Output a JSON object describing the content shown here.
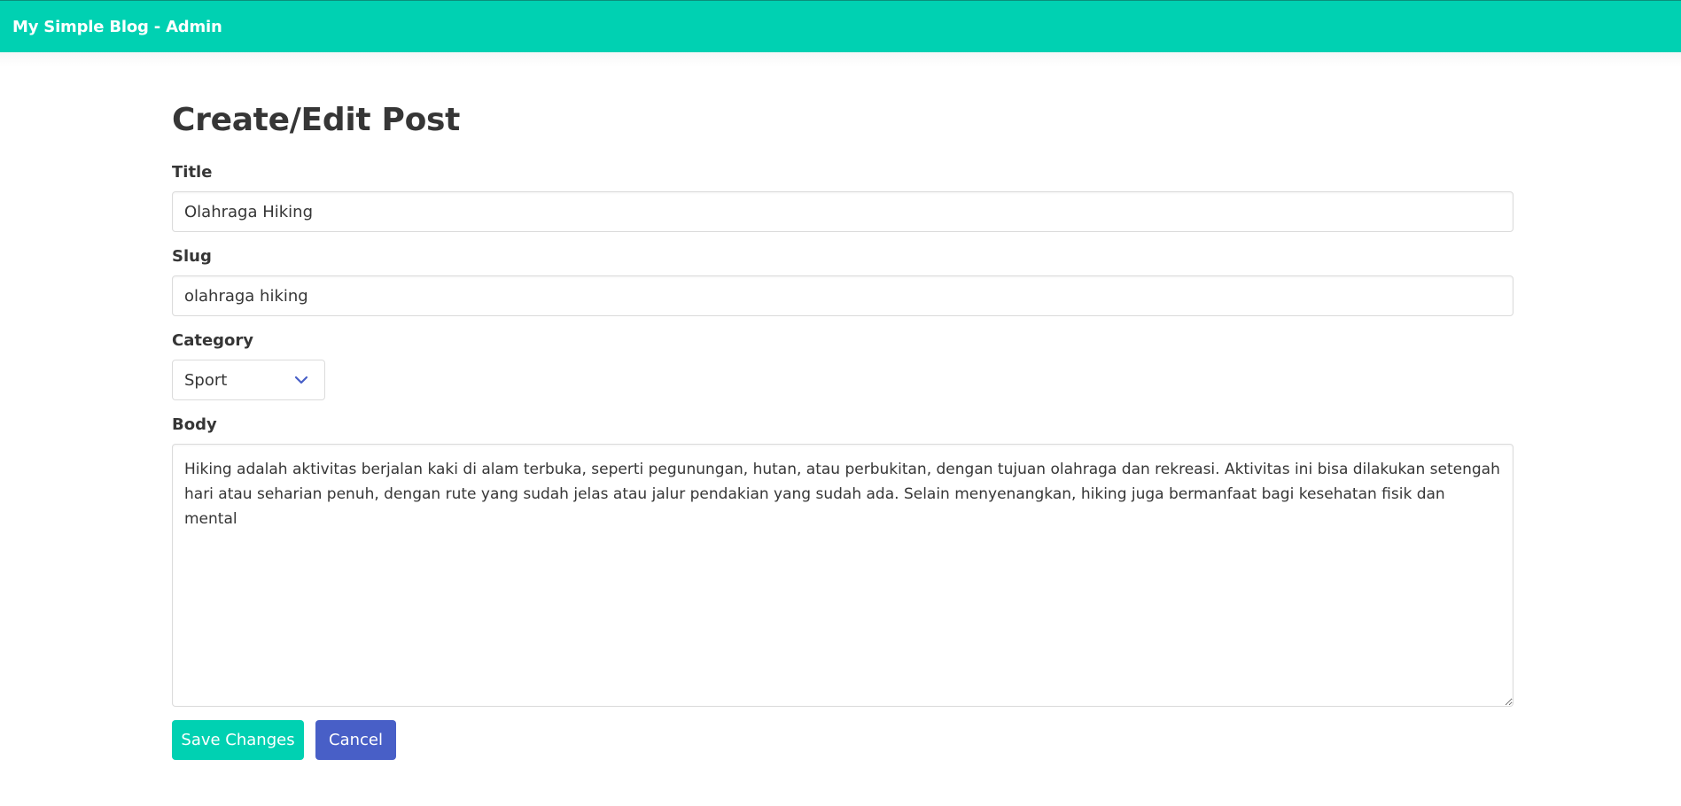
{
  "navbar": {
    "brand": "My Simple Blog - Admin",
    "color": "#00d1b2"
  },
  "page": {
    "title": "Create/Edit Post"
  },
  "form": {
    "title": {
      "label": "Title",
      "value": "Olahraga Hiking"
    },
    "slug": {
      "label": "Slug",
      "value": "olahraga hiking"
    },
    "category": {
      "label": "Category",
      "selected": "Sport",
      "icon": "chevron-down-icon"
    },
    "body": {
      "label": "Body",
      "value": "Hiking adalah aktivitas berjalan kaki di alam terbuka, seperti pegunungan, hutan, atau perbukitan, dengan tujuan olahraga dan rekreasi. Aktivitas ini bisa dilakukan setengah hari atau seharian penuh, dengan rute yang sudah jelas atau jalur pendakian yang sudah ada. Selain menyenangkan, hiking juga bermanfaat bagi kesehatan fisik dan mental"
    },
    "save_label": "Save Changes",
    "cancel_label": "Cancel"
  },
  "colors": {
    "primary": "#00d1b2",
    "link": "#485fc7"
  }
}
